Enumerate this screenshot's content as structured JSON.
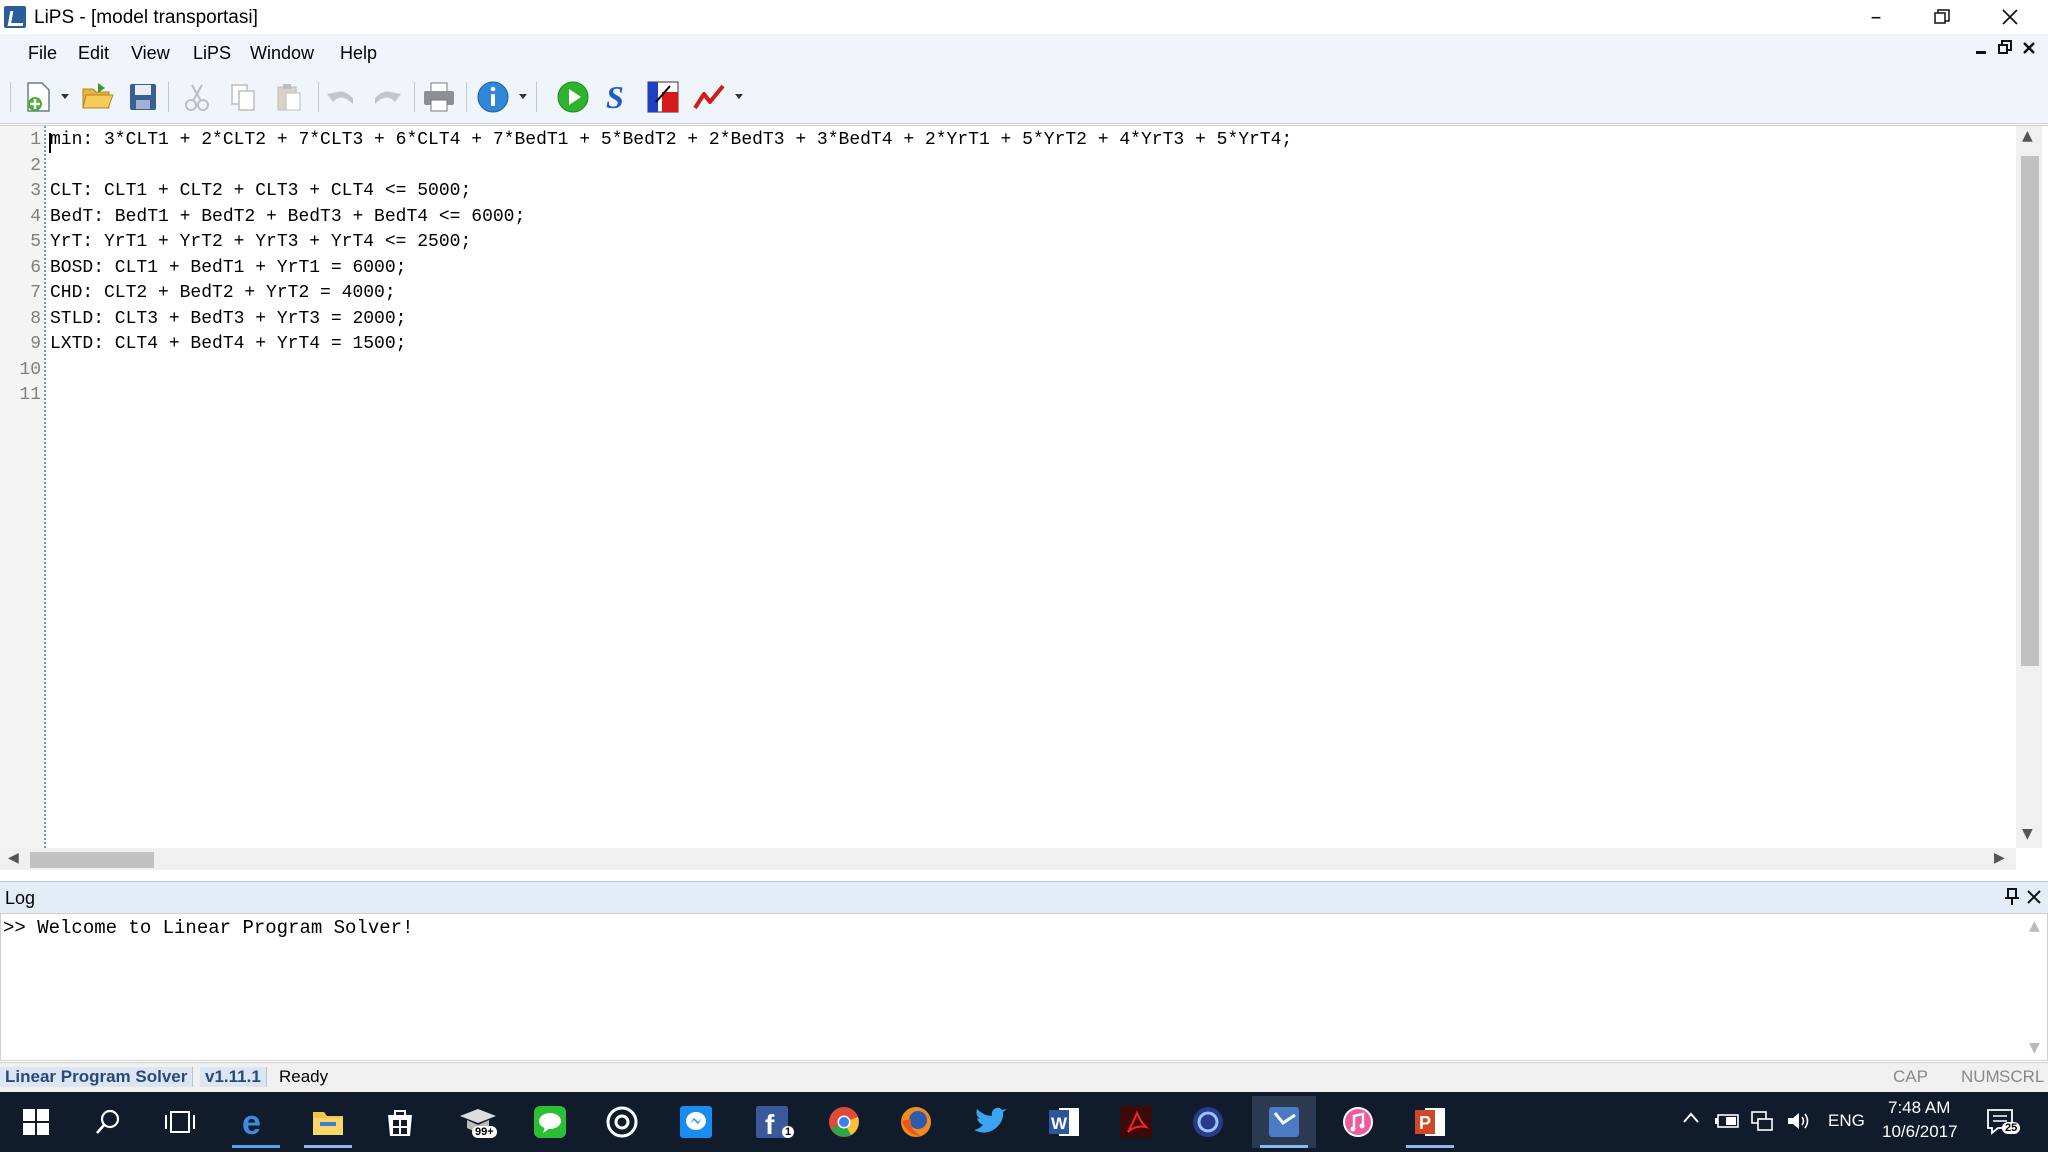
{
  "window": {
    "title": "LiPS - [model transportasi]"
  },
  "menu": [
    "File",
    "Edit",
    "View",
    "LiPS",
    "Window",
    "Help"
  ],
  "editor": {
    "line_numbers": [
      "1",
      "2",
      "3",
      "4",
      "5",
      "6",
      "7",
      "8",
      "9",
      "10",
      "11"
    ],
    "lines": [
      "min: 3*CLT1 + 2*CLT2 + 7*CLT3 + 6*CLT4 + 7*BedT1 + 5*BedT2 + 2*BedT3 + 3*BedT4 + 2*YrT1 + 5*YrT2 + 4*YrT3 + 5*YrT4;",
      "",
      "CLT: CLT1 + CLT2 + CLT3 + CLT4 <= 5000;",
      "BedT: BedT1 + BedT2 + BedT3 + BedT4 <= 6000;",
      "YrT: YrT1 + YrT2 + YrT3 + YrT4 <= 2500;",
      "BOSD: CLT1 + BedT1 + YrT1 = 6000;",
      "CHD: CLT2 + BedT2 + YrT2 = 4000;",
      "STLD: CLT3 + BedT3 + YrT3 = 2000;",
      "LXTD: CLT4 + BedT4 + YrT4 = 1500;",
      "",
      ""
    ]
  },
  "log": {
    "title": "Log",
    "line": ">> Welcome to Linear Program Solver!"
  },
  "status": {
    "app": "Linear Program Solver",
    "version": "v1.11.1",
    "state": "Ready",
    "keys": [
      "CAP",
      "NUM",
      "SCRL"
    ]
  },
  "taskbar": {
    "lang": "ENG",
    "time": "7:48 AM",
    "date": "10/6/2017",
    "notif_count": "25",
    "badges": {
      "mail": "99+",
      "facebook": "1"
    }
  },
  "colors": {
    "accent": "#2a5d9c",
    "taskbar": "#101c2c",
    "gutter_line": "#6aa0c8"
  }
}
